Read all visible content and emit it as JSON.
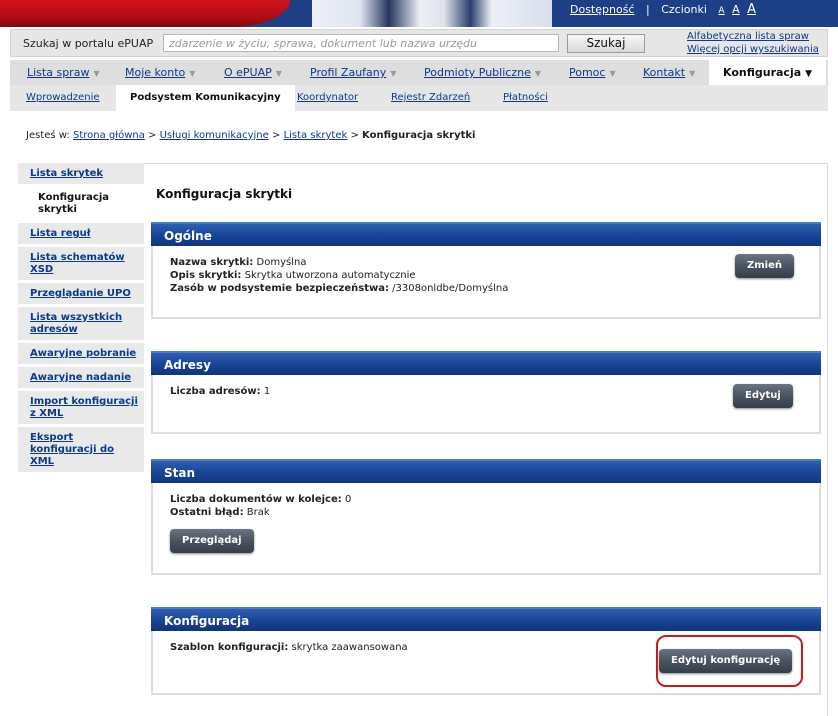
{
  "utility": {
    "accessibility": "Dostępność",
    "sep": "|",
    "fonts_label": "Czcionki",
    "font_small": "A",
    "font_medium": "A",
    "font_large": "A"
  },
  "search": {
    "label": "Szukaj w portalu ePUAP",
    "placeholder": "zdarzenie w życiu, sprawa, dokument lub nazwa urzędu",
    "button": "Szukaj",
    "alpha_list": "Alfabetyczna lista spraw",
    "more_options": "Więcej opcji wyszukiwania"
  },
  "mainnav": [
    {
      "label": "Lista spraw"
    },
    {
      "label": "Moje konto"
    },
    {
      "label": "O ePUAP"
    },
    {
      "label": "Profil Zaufany"
    },
    {
      "label": "Podmioty Publiczne"
    },
    {
      "label": "Pomoc"
    },
    {
      "label": "Kontakt"
    },
    {
      "label": "Konfiguracja"
    }
  ],
  "subnav": [
    {
      "label": "Wprowadzenie"
    },
    {
      "label": "Podsystem Komunikacyjny"
    },
    {
      "label": "Koordynator"
    },
    {
      "label": "Rejestr Zdarzeń"
    },
    {
      "label": "Płatności"
    }
  ],
  "breadcrumb": {
    "prefix": "Jesteś w:",
    "items": [
      "Strona główna",
      "Usługi komunikacyjne",
      "Lista skrytek"
    ],
    "sep": ">",
    "current": "Konfiguracja skrytki"
  },
  "sidebar": [
    {
      "label": "Lista skrytek"
    },
    {
      "label": "Konfiguracja skrytki"
    },
    {
      "label": "Lista reguł"
    },
    {
      "label": "Lista schematów XSD"
    },
    {
      "label": "Przeglądanie UPO"
    },
    {
      "label": "Lista wszystkich adresów"
    },
    {
      "label": "Awaryjne pobranie"
    },
    {
      "label": "Awaryjne nadanie"
    },
    {
      "label": "Import konfiguracji z XML"
    },
    {
      "label": "Eksport konfiguracji do XML"
    }
  ],
  "page_title": "Konfiguracja skrytki",
  "panels": {
    "general": {
      "title": "Ogólne",
      "name_label": "Nazwa skrytki:",
      "name_value": "Domyślna",
      "desc_label": "Opis skrytki:",
      "desc_value": "Skrytka utworzona automatycznie",
      "resource_label": "Zasób w podsystemie bezpieczeństwa:",
      "resource_value": "/3308onldbe/Domyślna",
      "button": "Zmień"
    },
    "addresses": {
      "title": "Adresy",
      "count_label": "Liczba adresów:",
      "count_value": "1",
      "button": "Edytuj"
    },
    "state": {
      "title": "Stan",
      "queue_label": "Liczba dokumentów w kolejce:",
      "queue_value": "0",
      "error_label": "Ostatni błąd:",
      "error_value": "Brak",
      "button": "Przeglądaj"
    },
    "config": {
      "title": "Konfiguracja",
      "template_label": "Szablon konfiguracji:",
      "template_value": "skrytka zaawansowana",
      "button": "Edytuj konfigurację"
    }
  },
  "colors": {
    "panel_header": "#1a4596",
    "link": "#0b3a8a",
    "highlight": "#cc1a1a",
    "dark_button": "#4a5360"
  }
}
